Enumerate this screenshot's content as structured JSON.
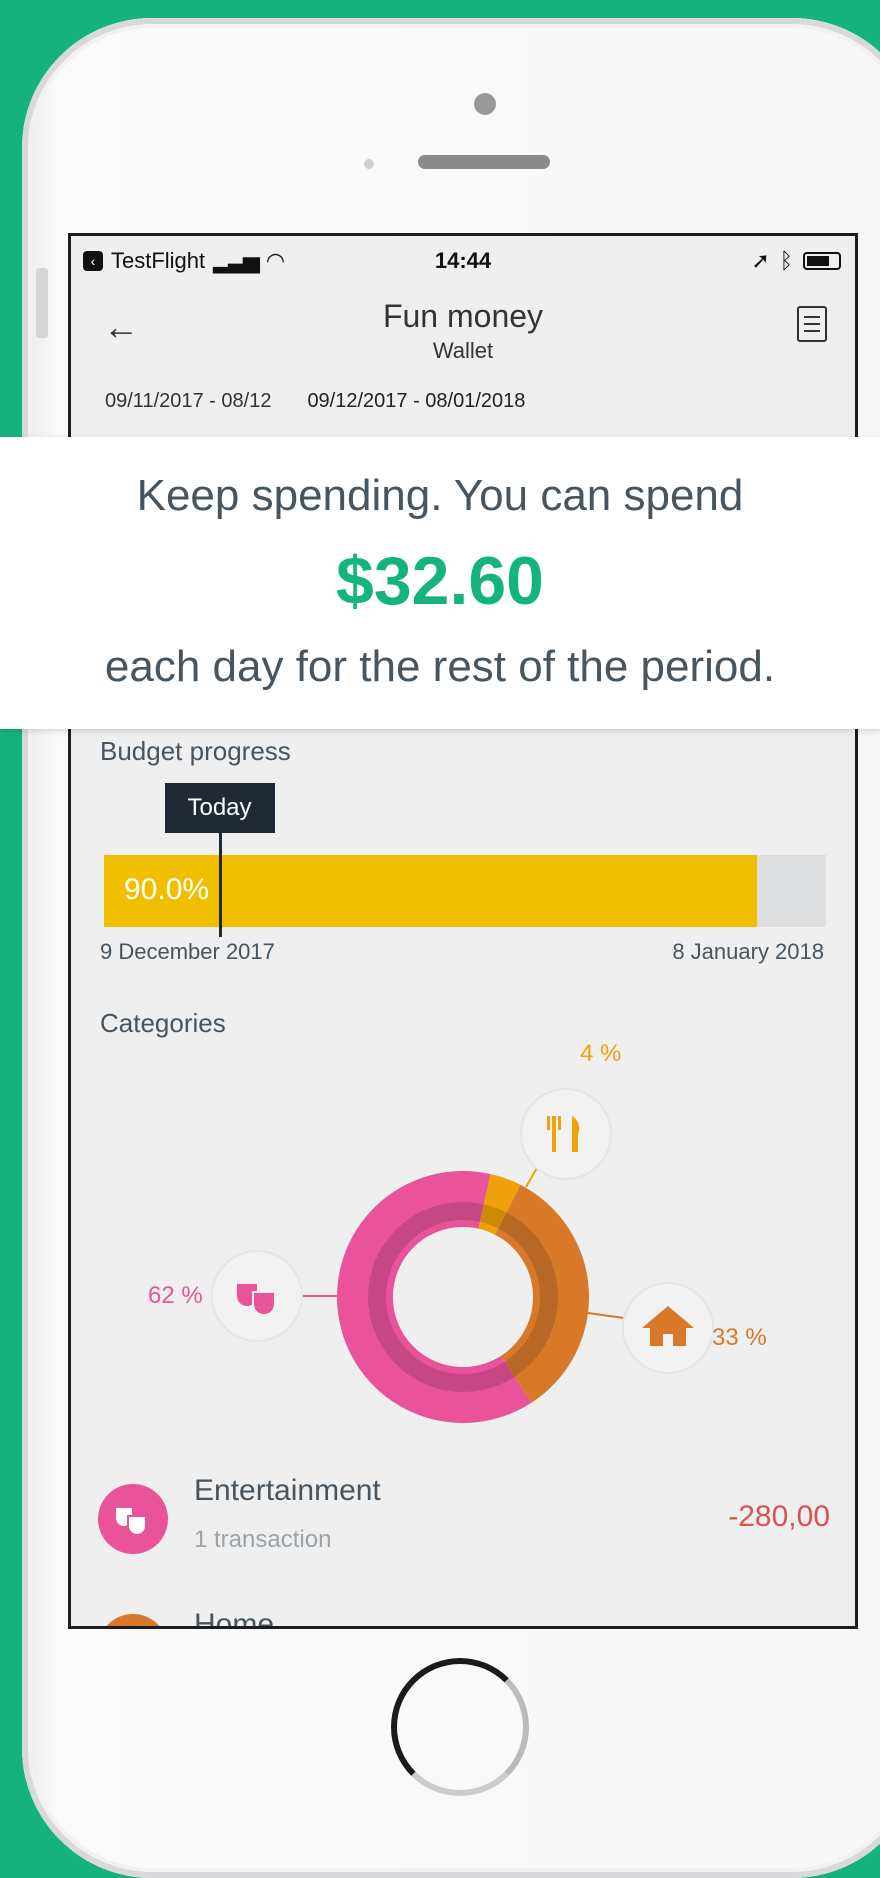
{
  "status_bar": {
    "carrier": "TestFlight",
    "time": "14:44"
  },
  "nav": {
    "title": "Fun money",
    "subtitle": "Wallet"
  },
  "period_tabs": [
    {
      "label": "09/11/2017 - 08/12"
    },
    {
      "label": "09/12/2017 - 08/01/2018"
    }
  ],
  "banner": {
    "line1": "Keep spending. You can spend",
    "amount": "$32.60",
    "line2": "each day for the rest of the period."
  },
  "budget": {
    "label": "Budget progress",
    "today_label": "Today",
    "percent_text": "90.0%",
    "fill_fraction": 0.905,
    "today_fraction": 0.16,
    "start_date": "9 December 2017",
    "end_date": "8 January 2018"
  },
  "categories": {
    "label": "Categories",
    "chart_data": {
      "type": "pie",
      "slices": [
        {
          "name": "Entertainment",
          "value": 62,
          "label": "62 %",
          "color": "#e8539a",
          "icon": "theater-masks-icon"
        },
        {
          "name": "Food",
          "value": 4,
          "label": "4 %",
          "color": "#f0a00a",
          "icon": "fork-knife-icon"
        },
        {
          "name": "Home",
          "value": 33,
          "label": "33 %",
          "color": "#d8792a",
          "icon": "house-icon"
        }
      ]
    }
  },
  "transactions": [
    {
      "name": "Entertainment",
      "sub": "1 transaction",
      "amount": "-280,00",
      "color": "#e8539a"
    },
    {
      "name": "Home",
      "color": "#d8792a"
    }
  ]
}
